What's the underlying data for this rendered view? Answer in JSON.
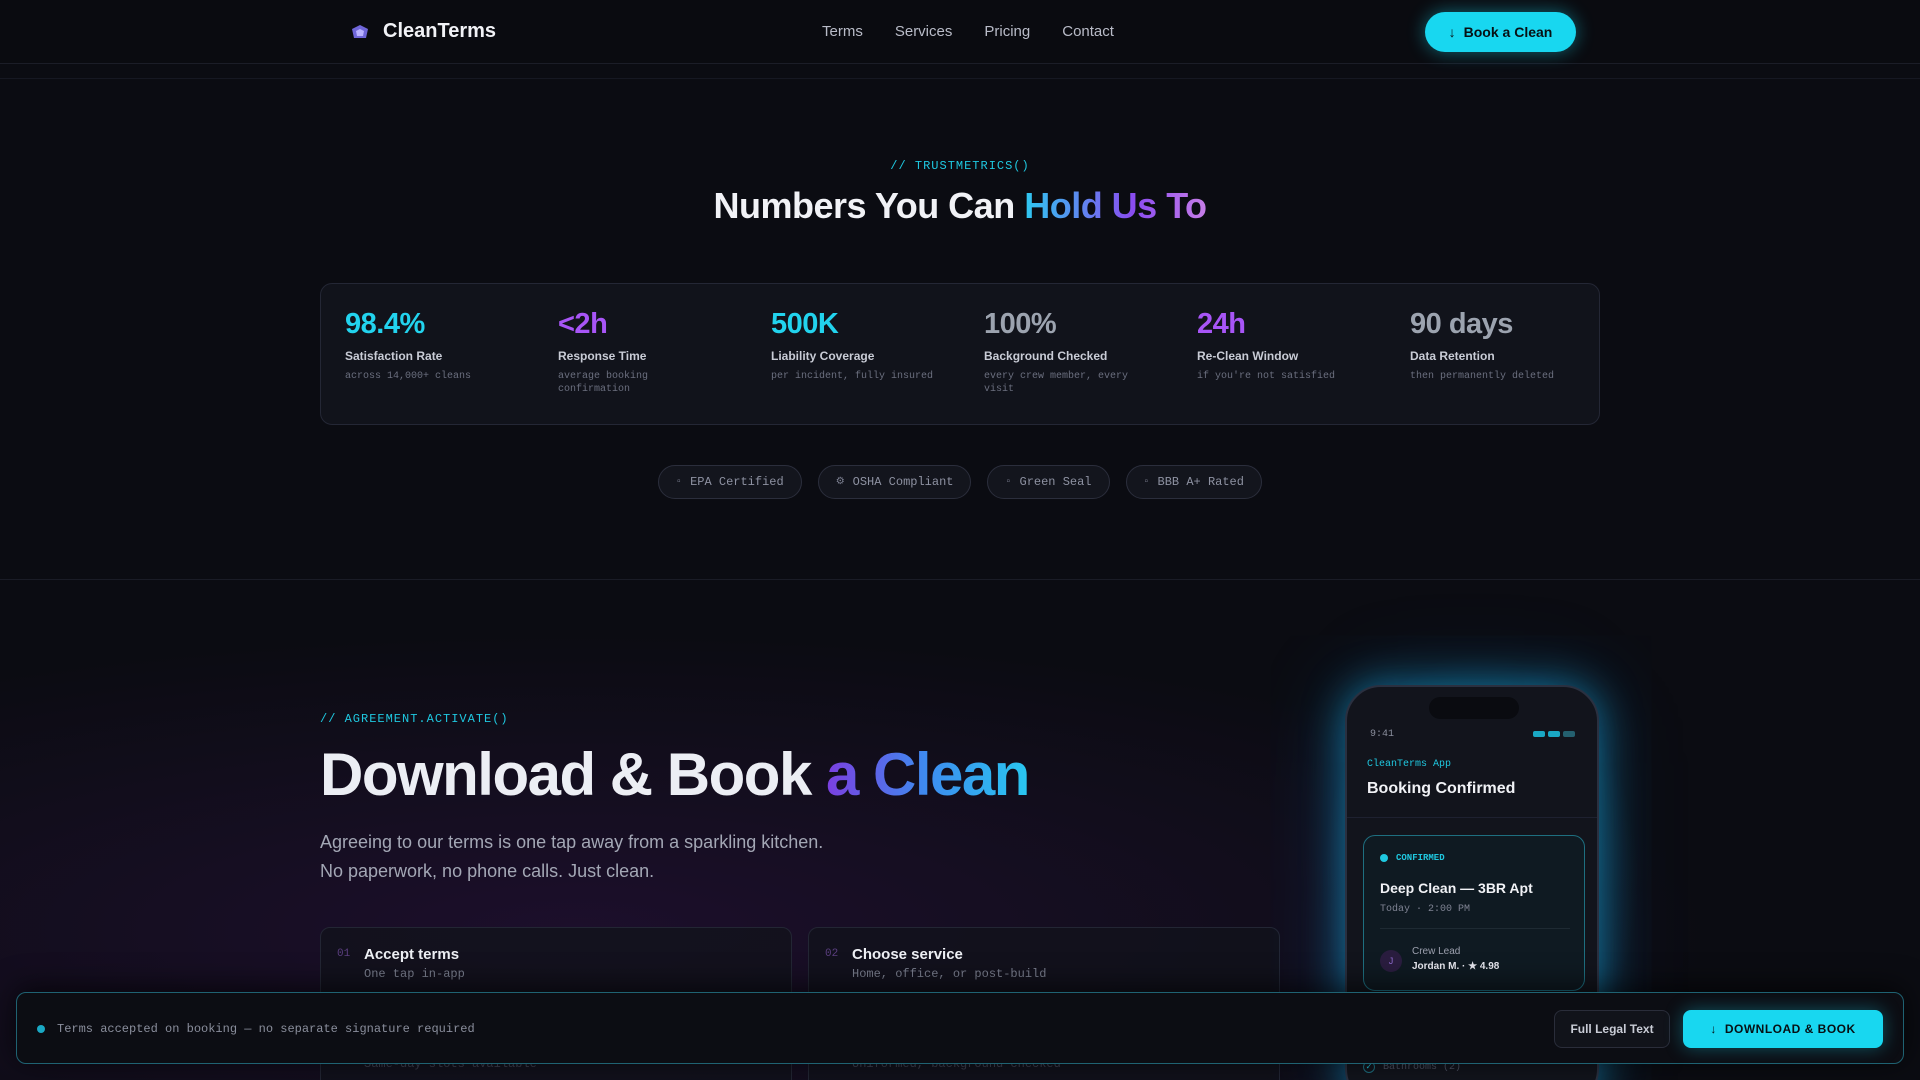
{
  "nav": {
    "brand": "CleanTerms",
    "links": [
      "Terms",
      "Services",
      "Pricing",
      "Contact"
    ],
    "cta": "Book a Clean"
  },
  "trust": {
    "eyebrow": "// TRUSTMETRICS()",
    "title_part1": "Numbers You Can ",
    "title_part2": "Hold Us To",
    "stats": [
      {
        "value": "98.4%",
        "label": "Satisfaction Rate",
        "sub": "across 14,000+ cleans",
        "color": "#22d3ee"
      },
      {
        "value": "<2h",
        "label": "Response Time",
        "sub": "average booking confirmation",
        "color": "#a855f7"
      },
      {
        "value": "500K",
        "label": "Liability Coverage",
        "sub": "per incident, fully insured",
        "color": "#22d3ee"
      },
      {
        "value": "100%",
        "label": "Background Checked",
        "sub": "every crew member, every visit",
        "color": "#9ca3af"
      },
      {
        "value": "24h",
        "label": "Re-Clean Window",
        "sub": "if you're not satisfied",
        "color": "#a855f7"
      },
      {
        "value": "90 days",
        "label": "Data Retention",
        "sub": "then permanently deleted",
        "color": "#9ca3af"
      }
    ],
    "badges": [
      {
        "icon": "leaf-icon",
        "label": "EPA Certified"
      },
      {
        "icon": "gear-icon",
        "label": "OSHA Compliant"
      },
      {
        "icon": "seal-icon",
        "label": "Green Seal"
      },
      {
        "icon": "star-icon",
        "label": "BBB A+ Rated"
      }
    ]
  },
  "download": {
    "eyebrow": "// AGREEMENT.ACTIVATE()",
    "title_part1": "Download & Book ",
    "title_part2": "a Clean",
    "lead_line1": "Agreeing to our terms is one tap away from a sparkling kitchen.",
    "lead_line2": "No paperwork, no phone calls. Just clean.",
    "steps": [
      {
        "num": "01",
        "title": "Accept terms",
        "desc": "One tap in-app",
        "ghost": "Same-day slots available"
      },
      {
        "num": "02",
        "title": "Choose service",
        "desc": "Home, office, or post-build",
        "ghost": "Uniformed, background checked"
      }
    ]
  },
  "phone": {
    "time": "9:41",
    "app": "CleanTerms App",
    "title": "Booking Confirmed",
    "status": "CONFIRMED",
    "job": "Deep Clean — 3BR Apt",
    "when": "Today · 2:00 PM",
    "avatar": "J",
    "crew_label": "Crew Lead",
    "crew": "Jordan M. · ★ 4.98",
    "checklist_item": "Bathrooms (2)"
  },
  "bar": {
    "note": "Terms accepted on booking — no separate signature required",
    "legal": "Full Legal Text",
    "download": "DOWNLOAD & BOOK"
  }
}
